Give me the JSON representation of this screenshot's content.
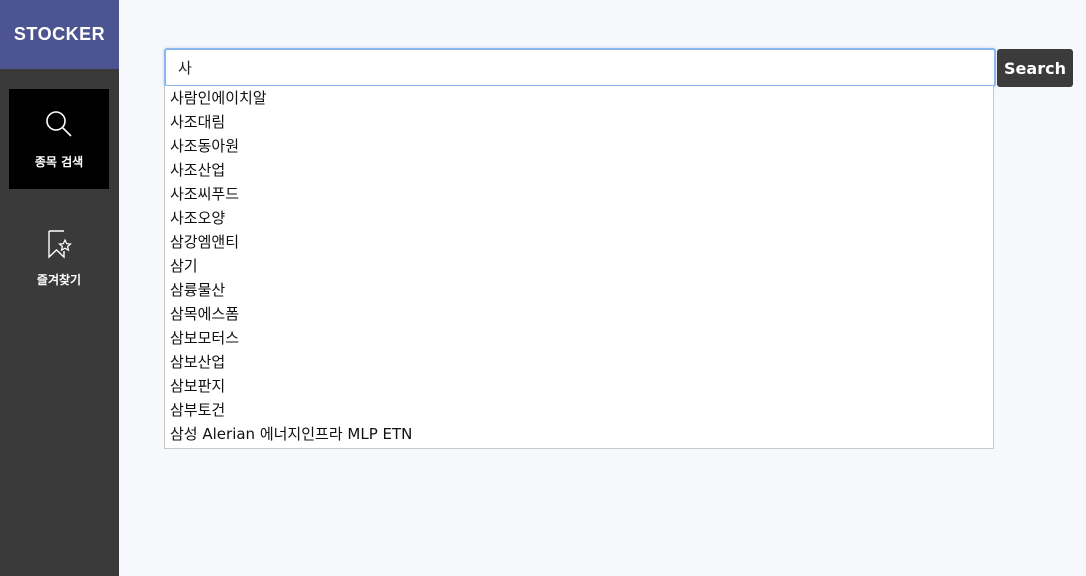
{
  "brand": {
    "title": "STOCKER"
  },
  "nav": {
    "items": [
      {
        "label": "종목 검색",
        "icon": "search-icon",
        "active": true
      },
      {
        "label": "즐겨찾기",
        "icon": "bookmark-star-icon",
        "active": false
      }
    ]
  },
  "search": {
    "value": "사",
    "button_label": "Search"
  },
  "suggestions": [
    "사람인에이치알",
    "사조대림",
    "사조동아원",
    "사조산업",
    "사조씨푸드",
    "사조오양",
    "삼강엠앤티",
    "삼기",
    "삼륭물산",
    "삼목에스폼",
    "삼보모터스",
    "삼보산업",
    "삼보판지",
    "삼부토건",
    "삼성 Alerian 에너지인프라 MLP ETN"
  ],
  "colors": {
    "sidebar": "#3a3a3a",
    "brand": "#4c5592",
    "active_nav": "#000000",
    "background": "#f7f8fb",
    "input_focus_border": "#8ab8ee",
    "button": "#3b3b3b"
  }
}
